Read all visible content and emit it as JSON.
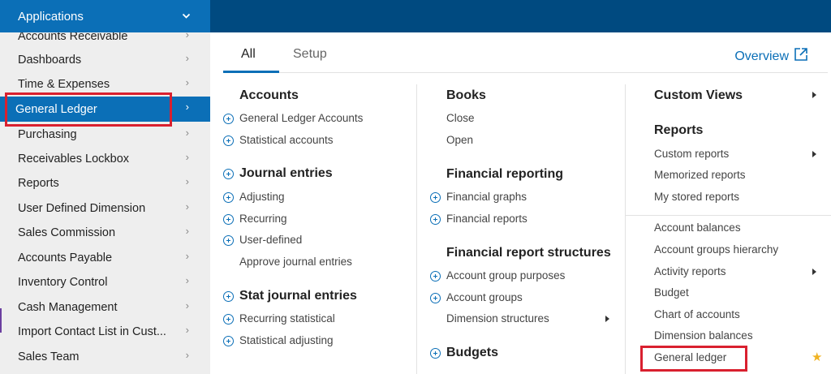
{
  "header": {
    "apps_label": "Applications"
  },
  "sidebar": {
    "items": [
      {
        "label": "Accounts Receivable"
      },
      {
        "label": "Dashboards"
      },
      {
        "label": "Time & Expenses"
      },
      {
        "label": "General Ledger"
      },
      {
        "label": "Purchasing"
      },
      {
        "label": "Receivables Lockbox"
      },
      {
        "label": "Reports"
      },
      {
        "label": "User Defined Dimension"
      },
      {
        "label": "Sales Commission"
      },
      {
        "label": "Accounts Payable"
      },
      {
        "label": "Inventory Control"
      },
      {
        "label": "Cash Management"
      },
      {
        "label": "Import Contact List in Cust..."
      },
      {
        "label": "Sales Team"
      }
    ]
  },
  "tabs": {
    "all": "All",
    "setup": "Setup"
  },
  "overview_label": "Overview",
  "col1": {
    "accounts": {
      "heading": "Accounts",
      "items": [
        "General Ledger Accounts",
        "Statistical accounts"
      ]
    },
    "journal": {
      "heading": "Journal entries",
      "items": [
        "Adjusting",
        "Recurring",
        "User-defined",
        "Approve journal entries"
      ]
    },
    "stat": {
      "heading": "Stat journal entries",
      "items": [
        "Recurring statistical",
        "Statistical adjusting"
      ]
    }
  },
  "col2": {
    "books": {
      "heading": "Books",
      "items": [
        "Close",
        "Open"
      ]
    },
    "reporting": {
      "heading": "Financial reporting",
      "items": [
        "Financial graphs",
        "Financial reports"
      ]
    },
    "structures": {
      "heading": "Financial report structures",
      "items": [
        "Account group purposes",
        "Account groups",
        "Dimension structures"
      ]
    },
    "budgets": {
      "heading": "Budgets"
    }
  },
  "col3": {
    "custom_views": "Custom Views",
    "reports": {
      "heading": "Reports",
      "items": [
        "Custom reports",
        "Memorized reports",
        "My stored reports"
      ]
    },
    "list": [
      "Account balances",
      "Account groups hierarchy",
      "Activity reports",
      "Budget",
      "Chart of accounts",
      "Dimension balances",
      "General ledger"
    ]
  }
}
